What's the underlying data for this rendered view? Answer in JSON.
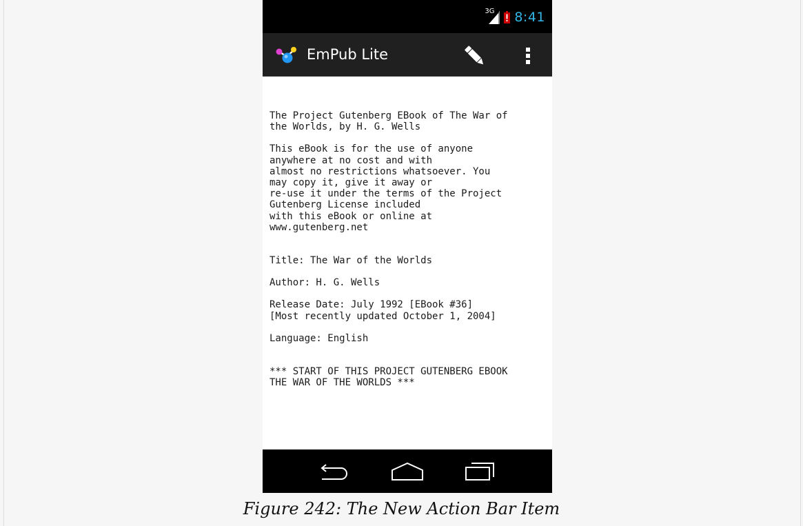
{
  "status_bar": {
    "network_type": "3G",
    "time": "8:41",
    "icons": [
      "signal-icon",
      "battery-low-icon"
    ]
  },
  "action_bar": {
    "title": "EmPub Lite",
    "logo_icon": "empub-logo-icon",
    "actions": [
      {
        "name": "edit",
        "icon": "pencil-icon"
      },
      {
        "name": "overflow",
        "icon": "overflow-menu-icon"
      }
    ]
  },
  "book": {
    "intro": "The Project Gutenberg EBook of The War of\nthe Worlds, by H. G. Wells",
    "license": "This eBook is for the use of anyone\nanywhere at no cost and with\nalmost no restrictions whatsoever. You\nmay copy it, give it away or\nre-use it under the terms of the Project\nGutenberg License included\nwith this eBook or online at\nwww.gutenberg.net",
    "title_line": "Title: The War of the Worlds",
    "author_line": "Author: H. G. Wells",
    "release_line": "Release Date: July 1992 [EBook #36]\n[Most recently updated October 1, 2004]",
    "language_line": "Language: English",
    "start_line": "*** START OF THIS PROJECT GUTENBERG EBOOK\nTHE WAR OF THE WORLDS ***"
  },
  "nav_bar": {
    "buttons": [
      {
        "name": "back",
        "icon": "back-icon"
      },
      {
        "name": "home",
        "icon": "home-icon"
      },
      {
        "name": "recent-apps",
        "icon": "recent-apps-icon"
      }
    ]
  },
  "caption": "Figure 242: The New Action Bar Item",
  "colors": {
    "accent_clock": "#33b5e5",
    "action_bar_bg": "#202020",
    "battery_low": "#cc0000"
  }
}
